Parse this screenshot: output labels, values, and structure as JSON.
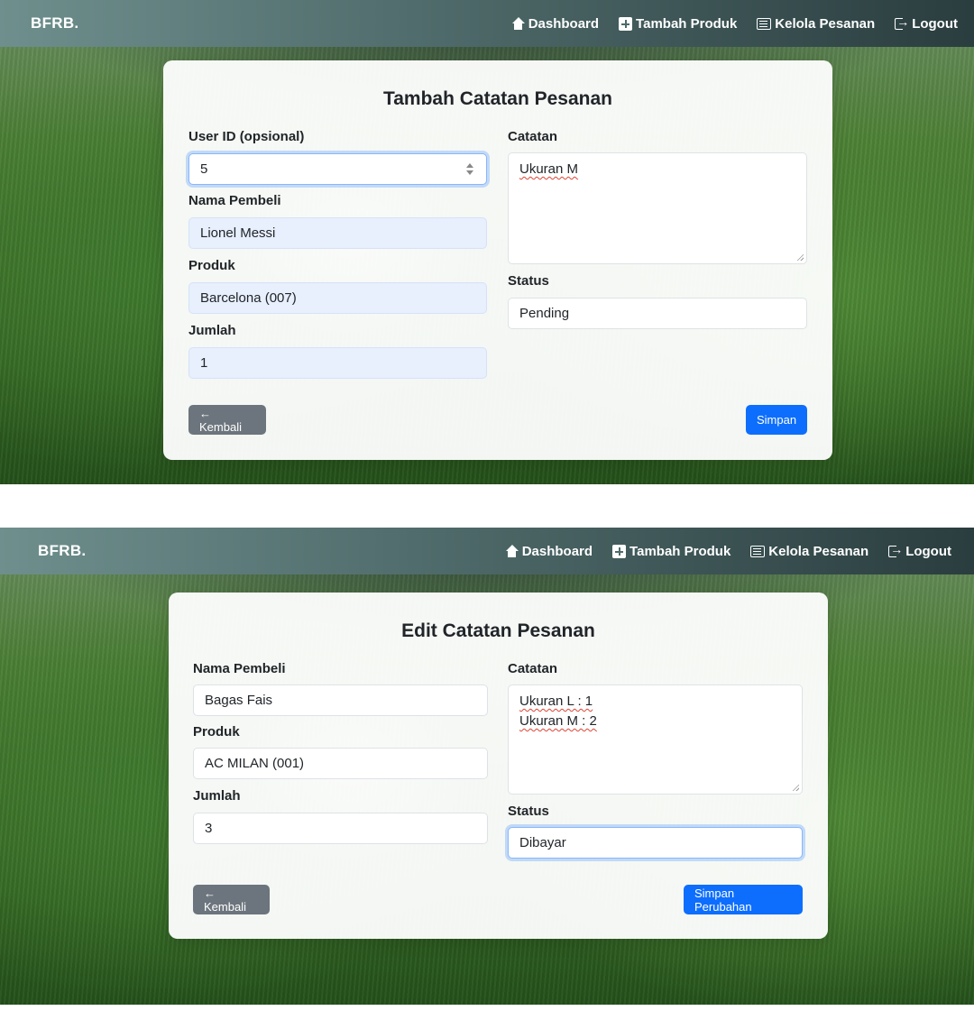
{
  "navbar": {
    "brand": "BFRB.",
    "items": [
      {
        "label": "Dashboard",
        "icon": "house-icon"
      },
      {
        "label": "Tambah Produk",
        "icon": "plus-square-icon"
      },
      {
        "label": "Kelola Pesanan",
        "icon": "list-icon"
      },
      {
        "label": "Logout",
        "icon": "logout-icon"
      }
    ]
  },
  "add_form": {
    "title": "Tambah Catatan Pesanan",
    "user_id_label": "User ID (opsional)",
    "user_id_value": "5",
    "buyer_label": "Nama Pembeli",
    "buyer_value": "Lionel Messi",
    "product_label": "Produk",
    "product_value": "Barcelona (007)",
    "qty_label": "Jumlah",
    "qty_value": "1",
    "notes_label": "Catatan",
    "notes_lines": [
      "Ukuran M"
    ],
    "status_label": "Status",
    "status_value": "Pending",
    "back_label": "← Kembali",
    "submit_label": "Simpan"
  },
  "edit_form": {
    "title": "Edit Catatan Pesanan",
    "buyer_label": "Nama Pembeli",
    "buyer_value": "Bagas Fais",
    "product_label": "Produk",
    "product_value": "AC MILAN (001)",
    "qty_label": "Jumlah",
    "qty_value": "3",
    "notes_label": "Catatan",
    "notes_lines": [
      "Ukuran L : 1",
      "Ukuran M : 2"
    ],
    "status_label": "Status",
    "status_value": "Dibayar",
    "back_label": "← Kembali",
    "submit_label": "Simpan Perubahan"
  },
  "colors": {
    "primary": "#0d6efd",
    "secondary": "#6c757d",
    "autofill": "#e8effd"
  }
}
